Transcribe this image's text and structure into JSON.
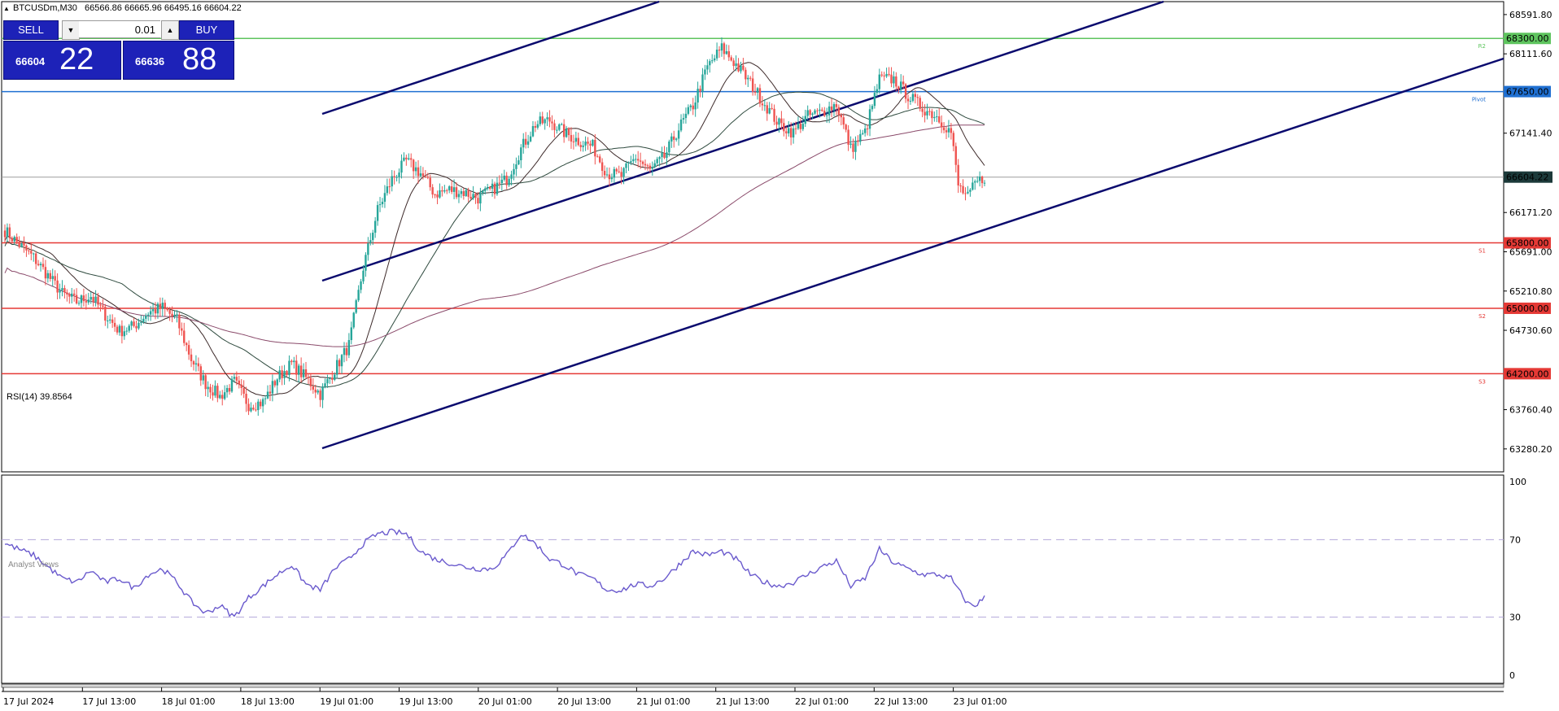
{
  "header": {
    "symbol_info": "BTCUSDm,M30",
    "ohlc": "66566.86 66665.96 66495.16 66604.22"
  },
  "trade_panel": {
    "sell_label": "SELL",
    "buy_label": "BUY",
    "volume": "0.01",
    "sell_price_main": "66604",
    "sell_price_big": "22",
    "buy_price_main": "66636",
    "buy_price_big": "88",
    "spin_down_icon": "triangle-down",
    "spin_up_icon": "triangle-up"
  },
  "rsi": {
    "label": "RSI(14) 39.8564",
    "levels": [
      "100",
      "70",
      "30",
      "0"
    ]
  },
  "analyst_tab": "Analyst Views",
  "colors": {
    "bull": "#26a69a",
    "bear": "#ef5350",
    "resistance": "#ff0000",
    "pivot": "#1f6fd1",
    "r2": "#5ec45e",
    "channel": "#000080",
    "rsi_line": "#6a5acd",
    "current_price_bg": "#1c3a3a"
  },
  "chart_data": {
    "type": "candlestick",
    "timeframe": "M30",
    "ylim": [
      63000,
      68750
    ],
    "price_ticks": [
      "68591.80",
      "68111.60",
      "67141.40",
      "66171.20",
      "65691.00",
      "65210.80",
      "64730.60",
      "63760.40",
      "63280.20"
    ],
    "time_ticks": [
      "17 Jul 2024",
      "17 Jul 13:00",
      "18 Jul 01:00",
      "18 Jul 13:00",
      "19 Jul 01:00",
      "19 Jul 13:00",
      "20 Jul 01:00",
      "20 Jul 13:00",
      "21 Jul 01:00",
      "21 Jul 13:00",
      "22 Jul 01:00",
      "22 Jul 13:00",
      "23 Jul 01:00"
    ],
    "levels": [
      {
        "name": "R2",
        "price": "68300.00",
        "value": 68300,
        "color": "#5ec45e"
      },
      {
        "name": "Pivot",
        "price": "67650.00",
        "value": 67650,
        "color": "#1f6fd1"
      },
      {
        "name": "S1",
        "price": "65800.00",
        "value": 65800,
        "color": "#e53935"
      },
      {
        "name": "S2",
        "price": "65000.00",
        "value": 65000,
        "color": "#e53935"
      },
      {
        "name": "S3",
        "price": "64200.00",
        "value": 64200,
        "color": "#e53935"
      }
    ],
    "current_price": "66604.22",
    "close_anchors": [
      [
        0,
        65950
      ],
      [
        6,
        65780
      ],
      [
        12,
        65620
      ],
      [
        18,
        65400
      ],
      [
        24,
        65180
      ],
      [
        30,
        65080
      ],
      [
        36,
        65150
      ],
      [
        42,
        64920
      ],
      [
        48,
        64720
      ],
      [
        54,
        64780
      ],
      [
        60,
        64950
      ],
      [
        66,
        65010
      ],
      [
        72,
        64850
      ],
      [
        78,
        64380
      ],
      [
        84,
        64080
      ],
      [
        90,
        63920
      ],
      [
        96,
        64100
      ],
      [
        102,
        63820
      ],
      [
        108,
        63850
      ],
      [
        114,
        64150
      ],
      [
        120,
        64320
      ],
      [
        126,
        64150
      ],
      [
        132,
        63950
      ],
      [
        138,
        64250
      ],
      [
        144,
        64550
      ],
      [
        150,
        65500
      ],
      [
        156,
        66200
      ],
      [
        162,
        66580
      ],
      [
        168,
        66800
      ],
      [
        174,
        66650
      ],
      [
        180,
        66400
      ],
      [
        186,
        66450
      ],
      [
        192,
        66420
      ],
      [
        198,
        66350
      ],
      [
        204,
        66450
      ],
      [
        210,
        66580
      ],
      [
        216,
        66950
      ],
      [
        222,
        67250
      ],
      [
        228,
        67300
      ],
      [
        234,
        67150
      ],
      [
        240,
        67050
      ],
      [
        246,
        66980
      ],
      [
        252,
        66650
      ],
      [
        258,
        66620
      ],
      [
        264,
        66850
      ],
      [
        270,
        66680
      ],
      [
        276,
        66850
      ],
      [
        282,
        67200
      ],
      [
        288,
        67480
      ],
      [
        294,
        67950
      ],
      [
        300,
        68180
      ],
      [
        306,
        67980
      ],
      [
        312,
        67750
      ],
      [
        318,
        67500
      ],
      [
        324,
        67250
      ],
      [
        330,
        67150
      ],
      [
        336,
        67350
      ],
      [
        342,
        67400
      ],
      [
        348,
        67500
      ],
      [
        354,
        66950
      ],
      [
        360,
        67150
      ],
      [
        366,
        67800
      ],
      [
        372,
        67800
      ],
      [
        378,
        67600
      ],
      [
        384,
        67450
      ],
      [
        390,
        67350
      ],
      [
        396,
        67150
      ],
      [
        399,
        66500
      ],
      [
        403,
        66350
      ],
      [
        406,
        66520
      ],
      [
        410,
        66604
      ]
    ],
    "rsi_anchors": [
      [
        0,
        68
      ],
      [
        6,
        65
      ],
      [
        12,
        62
      ],
      [
        18,
        56
      ],
      [
        24,
        50
      ],
      [
        30,
        48
      ],
      [
        36,
        54
      ],
      [
        42,
        48
      ],
      [
        48,
        50
      ],
      [
        54,
        45
      ],
      [
        60,
        52
      ],
      [
        66,
        55
      ],
      [
        72,
        48
      ],
      [
        78,
        38
      ],
      [
        84,
        32
      ],
      [
        90,
        36
      ],
      [
        96,
        30
      ],
      [
        102,
        40
      ],
      [
        108,
        46
      ],
      [
        114,
        52
      ],
      [
        120,
        57
      ],
      [
        126,
        47
      ],
      [
        132,
        44
      ],
      [
        138,
        55
      ],
      [
        144,
        60
      ],
      [
        150,
        68
      ],
      [
        156,
        73
      ],
      [
        162,
        74
      ],
      [
        168,
        73
      ],
      [
        174,
        64
      ],
      [
        180,
        60
      ],
      [
        186,
        58
      ],
      [
        192,
        56
      ],
      [
        198,
        55
      ],
      [
        204,
        55
      ],
      [
        210,
        62
      ],
      [
        216,
        73
      ],
      [
        222,
        68
      ],
      [
        228,
        60
      ],
      [
        234,
        57
      ],
      [
        240,
        52
      ],
      [
        246,
        50
      ],
      [
        252,
        44
      ],
      [
        258,
        44
      ],
      [
        264,
        47
      ],
      [
        270,
        46
      ],
      [
        276,
        50
      ],
      [
        282,
        57
      ],
      [
        288,
        64
      ],
      [
        294,
        62
      ],
      [
        300,
        64
      ],
      [
        306,
        60
      ],
      [
        312,
        52
      ],
      [
        318,
        48
      ],
      [
        324,
        46
      ],
      [
        330,
        48
      ],
      [
        336,
        52
      ],
      [
        342,
        56
      ],
      [
        348,
        59
      ],
      [
        354,
        46
      ],
      [
        360,
        50
      ],
      [
        366,
        65
      ],
      [
        372,
        58
      ],
      [
        378,
        55
      ],
      [
        384,
        52
      ],
      [
        390,
        52
      ],
      [
        396,
        50
      ],
      [
        399,
        44
      ],
      [
        403,
        37
      ],
      [
        406,
        36
      ],
      [
        410,
        40
      ]
    ]
  }
}
